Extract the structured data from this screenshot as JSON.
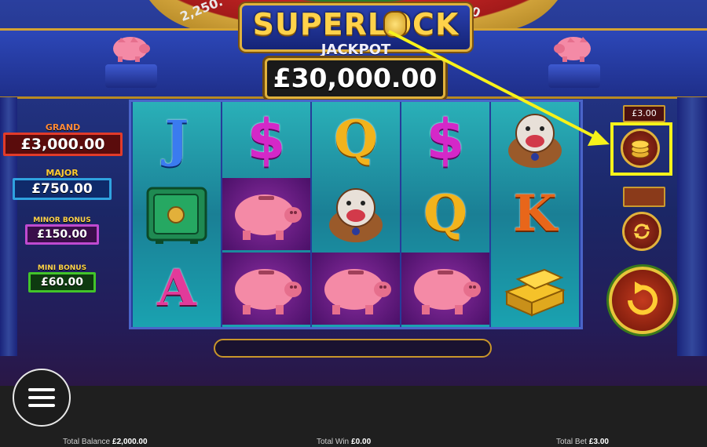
{
  "game": {
    "logo_title": "SUPERLOCK",
    "logo_subtitle": "JACKPOT",
    "jackpot_value": "£30,000.00",
    "wheel_left": "2,250.",
    "wheel_right": "0"
  },
  "prizes": [
    {
      "label": "GRAND",
      "value": "£3,000.00",
      "color": "#e23b2a"
    },
    {
      "label": "MAJOR",
      "value": "£750.00",
      "color": "#2fa3e0"
    },
    {
      "label": "MINOR BONUS",
      "value": "£150.00",
      "color": "#c04ad0"
    },
    {
      "label": "MINI BONUS",
      "value": "£60.00",
      "color": "#42c42a"
    }
  ],
  "reels": [
    [
      "J",
      "safe",
      "A"
    ],
    [
      "$",
      "pig",
      "pig"
    ],
    [
      "Q",
      "bulldog",
      "pig"
    ],
    [
      "$",
      "Q",
      "pig"
    ],
    [
      "bulldog",
      "K",
      "gold"
    ]
  ],
  "controls": {
    "bet_display": "£3.00",
    "coin_icon": "coin-stack-icon",
    "autoplay_icon": "autoplay-icon",
    "spin_icon": "spin-icon",
    "highlight_color": "#f7f21a"
  },
  "footer": {
    "balance_label": "Total Balance",
    "balance_value": "£2,000.00",
    "win_label": "Total Win",
    "win_value": "£0.00",
    "bet_label": "Total Bet",
    "bet_value": "£3.00"
  }
}
